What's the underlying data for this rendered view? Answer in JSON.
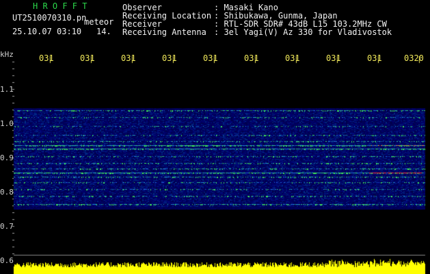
{
  "header": {
    "software_name": "H R O F F T",
    "filename": "UT2510070310.pn",
    "mode_label": "meteor",
    "datetime": "25.10.07 03:10",
    "frame_index": "14.",
    "info": [
      {
        "label": "Observer",
        "value": ": Masaki Kano"
      },
      {
        "label": "Receiving Location",
        "value": ": Shibukawa, Gunma, Japan"
      },
      {
        "label": "Receiver",
        "value": ": RTL-SDR SDR# 43dB L15 103.2MHz CW"
      },
      {
        "label": "Receiving Antenna",
        "value": ": 3el Yagi(V) Az 330 for Vladivostok"
      }
    ]
  },
  "axis": {
    "y_unit": "kHz",
    "y_ticks": [
      "1.1",
      "1.0",
      "0.9",
      "0.8",
      "0.7",
      "0.6"
    ],
    "x_ticks": [
      "031",
      "031",
      "031",
      "031",
      "031",
      "031",
      "031",
      "031",
      "031",
      "0320"
    ]
  },
  "colors": {
    "background": "#000000",
    "waterfall_base": "#00007a",
    "signal_line": "#2bd84a",
    "carrier_red": "#ff3030",
    "histogram": "#ffff00"
  }
}
